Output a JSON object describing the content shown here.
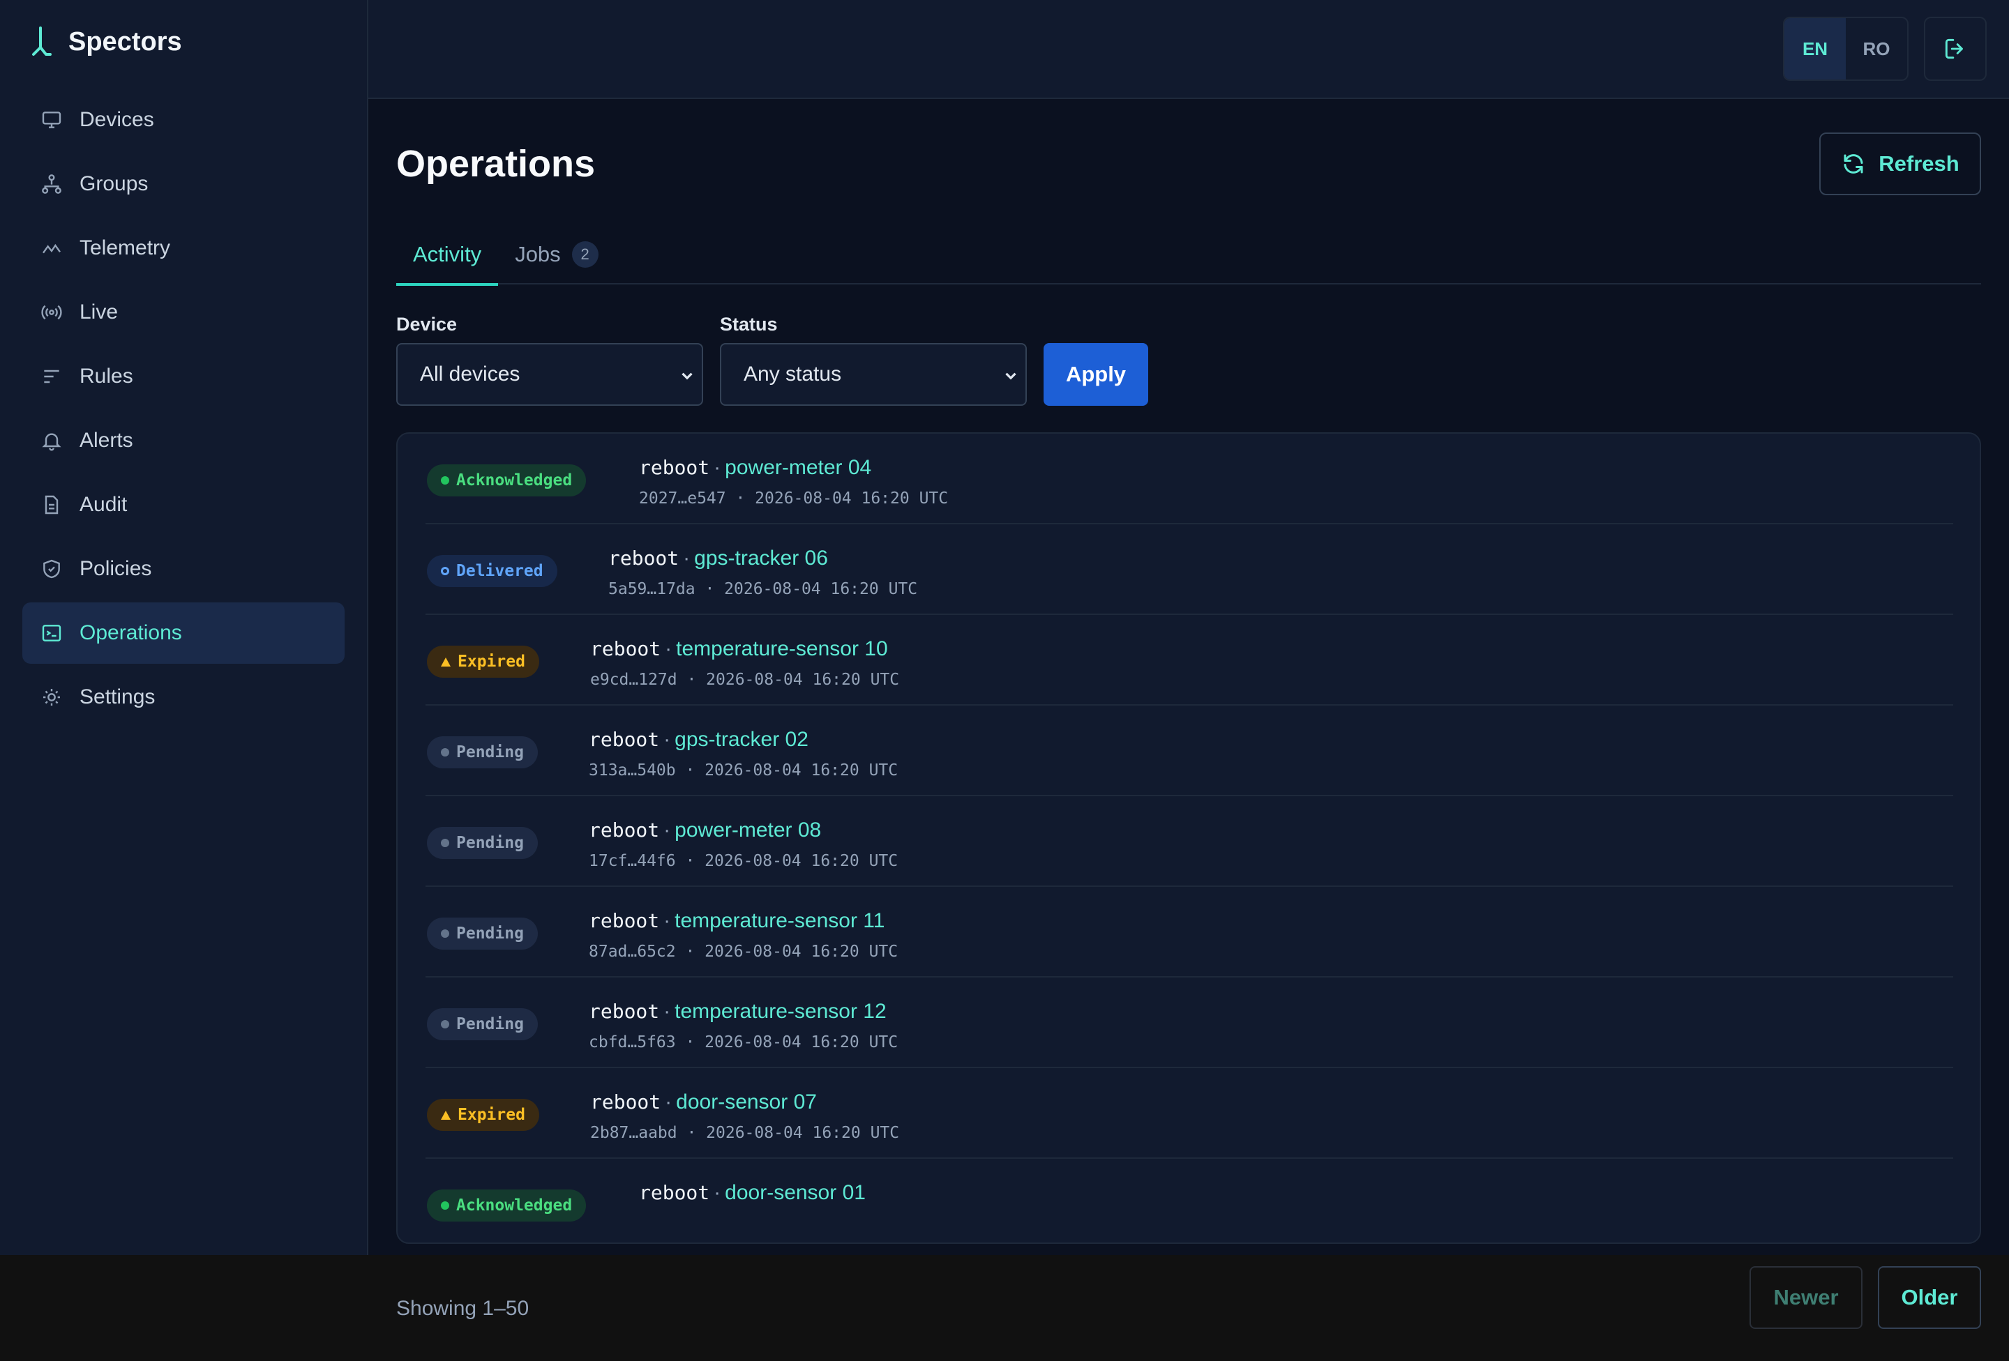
{
  "app": {
    "name": "Spectors"
  },
  "sidebar": {
    "items": [
      {
        "label": "Devices",
        "icon": "monitor-icon"
      },
      {
        "label": "Groups",
        "icon": "hierarchy-icon"
      },
      {
        "label": "Telemetry",
        "icon": "activity-line-icon"
      },
      {
        "label": "Live",
        "icon": "broadcast-icon"
      },
      {
        "label": "Rules",
        "icon": "filter-lines-icon"
      },
      {
        "label": "Alerts",
        "icon": "bell-icon"
      },
      {
        "label": "Audit",
        "icon": "document-icon"
      },
      {
        "label": "Policies",
        "icon": "shield-check-icon"
      },
      {
        "label": "Operations",
        "icon": "terminal-icon",
        "active": true
      },
      {
        "label": "Settings",
        "icon": "sun-gear-icon"
      }
    ]
  },
  "topbar": {
    "lang_en": "EN",
    "lang_ro": "RO",
    "active_lang": "EN"
  },
  "page": {
    "title": "Operations",
    "refresh_label": "Refresh",
    "tabs": [
      {
        "label": "Activity",
        "active": true
      },
      {
        "label": "Jobs",
        "count": "2"
      }
    ]
  },
  "filters": {
    "device_label": "Device",
    "device_value": "All devices",
    "status_label": "Status",
    "status_value": "Any status",
    "apply_label": "Apply"
  },
  "activity": [
    {
      "status": "Acknowledged",
      "kind": "ack",
      "command": "reboot",
      "device": "power-meter 04",
      "id": "2027…e547",
      "time": "2026-08-04 16:20 UTC"
    },
    {
      "status": "Delivered",
      "kind": "del",
      "command": "reboot",
      "device": "gps-tracker 06",
      "id": "5a59…17da",
      "time": "2026-08-04 16:20 UTC"
    },
    {
      "status": "Expired",
      "kind": "exp",
      "command": "reboot",
      "device": "temperature-sensor 10",
      "id": "e9cd…127d",
      "time": "2026-08-04 16:20 UTC"
    },
    {
      "status": "Pending",
      "kind": "pen",
      "command": "reboot",
      "device": "gps-tracker 02",
      "id": "313a…540b",
      "time": "2026-08-04 16:20 UTC"
    },
    {
      "status": "Pending",
      "kind": "pen",
      "command": "reboot",
      "device": "power-meter 08",
      "id": "17cf…44f6",
      "time": "2026-08-04 16:20 UTC"
    },
    {
      "status": "Pending",
      "kind": "pen",
      "command": "reboot",
      "device": "temperature-sensor 11",
      "id": "87ad…65c2",
      "time": "2026-08-04 16:20 UTC"
    },
    {
      "status": "Pending",
      "kind": "pen",
      "command": "reboot",
      "device": "temperature-sensor 12",
      "id": "cbfd…5f63",
      "time": "2026-08-04 16:20 UTC"
    },
    {
      "status": "Expired",
      "kind": "exp",
      "command": "reboot",
      "device": "door-sensor 07",
      "id": "2b87…aabd",
      "time": "2026-08-04 16:20 UTC"
    },
    {
      "status": "Acknowledged",
      "kind": "ack",
      "command": "reboot",
      "device": "door-sensor 01",
      "id": "",
      "time": ""
    }
  ],
  "footer": {
    "showing": "Showing 1–50",
    "newer_label": "Newer",
    "older_label": "Older"
  },
  "colors": {
    "accent": "#5eead4",
    "primary": "#1d5fd6",
    "background": "#0b1120",
    "surface": "#111a2e"
  }
}
